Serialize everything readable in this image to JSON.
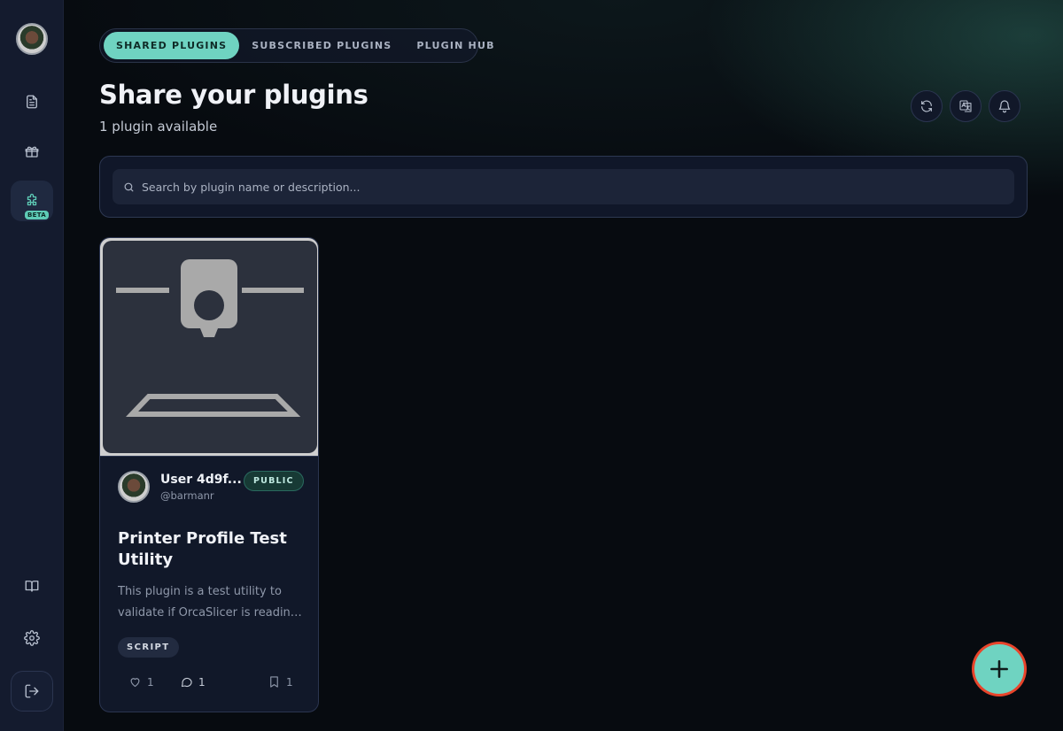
{
  "tabs": [
    {
      "label": "SHARED PLUGINS",
      "active": true
    },
    {
      "label": "SUBSCRIBED PLUGINS",
      "active": false
    },
    {
      "label": "PLUGIN HUB",
      "active": false
    }
  ],
  "header": {
    "title": "Share your plugins",
    "subtitle": "1 plugin available"
  },
  "sidebar": {
    "items": [
      {
        "icon": "document-icon"
      },
      {
        "icon": "gift-icon"
      },
      {
        "icon": "puzzle-icon",
        "badge": "BETA",
        "active": true
      },
      {
        "icon": "book-icon"
      },
      {
        "icon": "gear-icon"
      },
      {
        "icon": "logout-icon"
      }
    ]
  },
  "top_actions": [
    {
      "icon": "refresh-icon"
    },
    {
      "icon": "translate-icon"
    },
    {
      "icon": "bell-icon"
    }
  ],
  "search": {
    "placeholder": "Search by plugin name or description..."
  },
  "plugins": [
    {
      "user_name": "User 4d9f...",
      "user_handle": "@barmanr",
      "visibility": "PUBLIC",
      "title": "Printer Profile Test Utility",
      "description": "This plugin is a test utility to validate if OrcaSlicer is reading printer profiles correctly.",
      "type": "SCRIPT",
      "likes": "1",
      "comments": "1",
      "bookmarks": "1"
    }
  ],
  "colors": {
    "accent": "#6fd3c1",
    "sidebar_bg": "#141b2e",
    "page_bg": "#070b10",
    "fab_outline": "#e8442b"
  }
}
